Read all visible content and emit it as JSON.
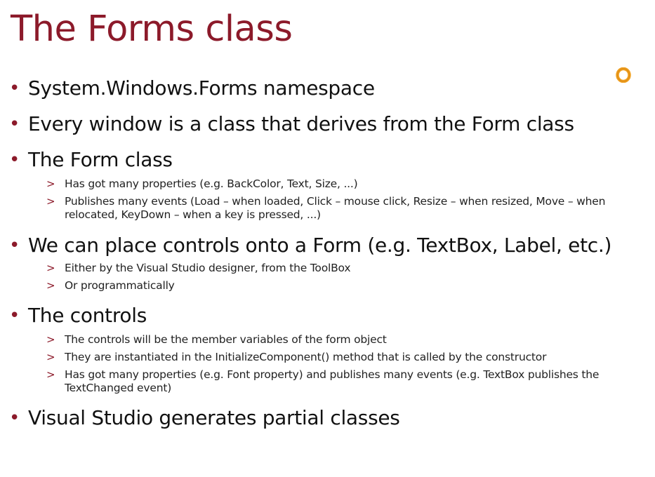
{
  "slide": {
    "title": "The Forms class",
    "logo_icon": "orange-ring-icon",
    "colors": {
      "title": "#8c1a2a",
      "bullet": "#8c1a2a",
      "logo": "#f0a020"
    },
    "bullets": [
      {
        "text": "System.Windows.Forms namespace"
      },
      {
        "text": "Every window is a class that derives from the Form class"
      },
      {
        "text": "The Form class",
        "sub": [
          "Has got many properties (e.g. BackColor, Text, Size, ...)",
          "Publishes many events (Load – when loaded, Click – mouse click, Resize – when resized, Move – when relocated, KeyDown – when a key is pressed, ...)"
        ]
      },
      {
        "text": "We can place controls onto a Form (e.g. TextBox, Label, etc.)",
        "sub": [
          "Either by the Visual Studio designer, from the ToolBox",
          "Or programmatically"
        ]
      },
      {
        "text": "The controls",
        "sub": [
          "The controls will be the member variables of the form object",
          "They are instantiated in the InitializeComponent() method that is called by the constructor",
          "Has got many properties (e.g. Font property) and publishes many events (e.g. TextBox publishes the TextChanged event)"
        ]
      },
      {
        "text": "Visual Studio generates partial classes"
      }
    ]
  }
}
